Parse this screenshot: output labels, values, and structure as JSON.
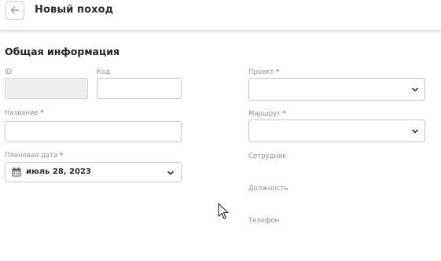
{
  "header": {
    "title": "Новый поход",
    "back_icon": "arrow-left-icon"
  },
  "section": {
    "title": "Общая информация"
  },
  "fields": {
    "id": {
      "label": "ID",
      "value": ""
    },
    "code": {
      "label": "Код",
      "value": ""
    },
    "name": {
      "label": "Название",
      "required": "*",
      "value": ""
    },
    "planned_date": {
      "label": "Плановая дата",
      "required": "*",
      "value": "июль 28, 2023",
      "icon": "calendar-icon"
    },
    "project": {
      "label": "Проект",
      "required": "*",
      "value": ""
    },
    "route": {
      "label": "Маршрут",
      "required": "*",
      "value": ""
    },
    "employee": {
      "label": "Сотрудник"
    },
    "position": {
      "label": "Должность"
    },
    "phone": {
      "label": "Телефон"
    }
  },
  "colors": {
    "required": "#d9363e",
    "label": "#8f8f8f",
    "border": "#c6c6c6",
    "disabled_bg": "#efefef"
  }
}
